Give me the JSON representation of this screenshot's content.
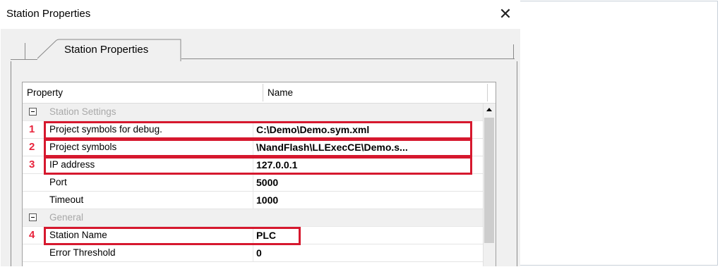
{
  "window": {
    "title": "Station Properties",
    "close_glyph": "✕"
  },
  "tabs": [
    {
      "label": "Station Properties",
      "selected": true
    }
  ],
  "grid": {
    "columns": [
      "Property",
      "Name"
    ],
    "categories": [
      {
        "label": "Station Settings",
        "expander": "minus",
        "rows": [
          {
            "marker": "1",
            "property": "Project symbols for debug.",
            "value": "C:\\Demo\\Demo.sym.xml",
            "highlighted": true
          },
          {
            "marker": "2",
            "property": "Project symbols",
            "value": "\\NandFlash\\LLExecCE\\Demo.s...",
            "highlighted": true
          },
          {
            "marker": "3",
            "property": "IP address",
            "value": "127.0.0.1",
            "highlighted": true
          },
          {
            "marker": "",
            "property": "Port",
            "value": "5000",
            "highlighted": false
          },
          {
            "marker": "",
            "property": "Timeout",
            "value": "1000",
            "highlighted": false
          }
        ]
      },
      {
        "label": "General",
        "expander": "minus",
        "rows": [
          {
            "marker": "4",
            "property": "Station Name",
            "value": "PLC",
            "highlighted": true
          },
          {
            "marker": "",
            "property": "Error Threshold",
            "value": "0",
            "highlighted": false
          }
        ]
      }
    ]
  },
  "colors": {
    "highlight": "#d6182e",
    "marker": "#e8243c",
    "category_text": "#a8a8a8"
  },
  "icons": {
    "close": "close-icon",
    "expander": "collapse-minus-icon",
    "scroll_up": "scroll-up-arrow-icon"
  }
}
